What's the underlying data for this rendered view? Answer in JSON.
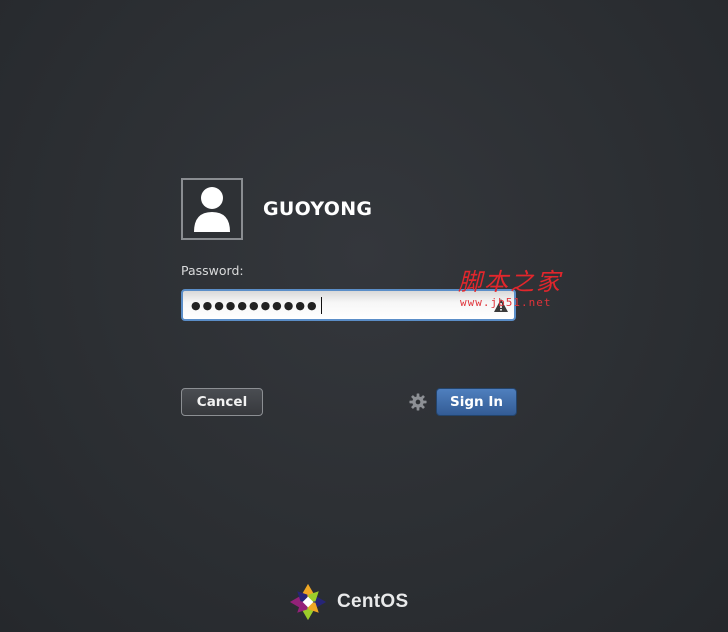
{
  "user": {
    "name": "GUOYONG"
  },
  "password": {
    "label": "Password:",
    "masked_value": "●●●●●●●●●●●",
    "char_count": 11
  },
  "buttons": {
    "cancel": "Cancel",
    "sign_in": "Sign In"
  },
  "watermark": {
    "title": "脚本之家",
    "url": "www.jb51.net"
  },
  "brand": {
    "name": "CentOS"
  },
  "icons": {
    "avatar": "user-silhouette-icon",
    "caps_lock": "caps-lock-warning-icon",
    "settings": "gear-icon",
    "logo": "centos-logo-icon"
  },
  "colors": {
    "background": "#2c2f33",
    "field_focus": "#5b8ec8",
    "sign_in": "#3f6dab",
    "watermark": "#e2262c"
  }
}
